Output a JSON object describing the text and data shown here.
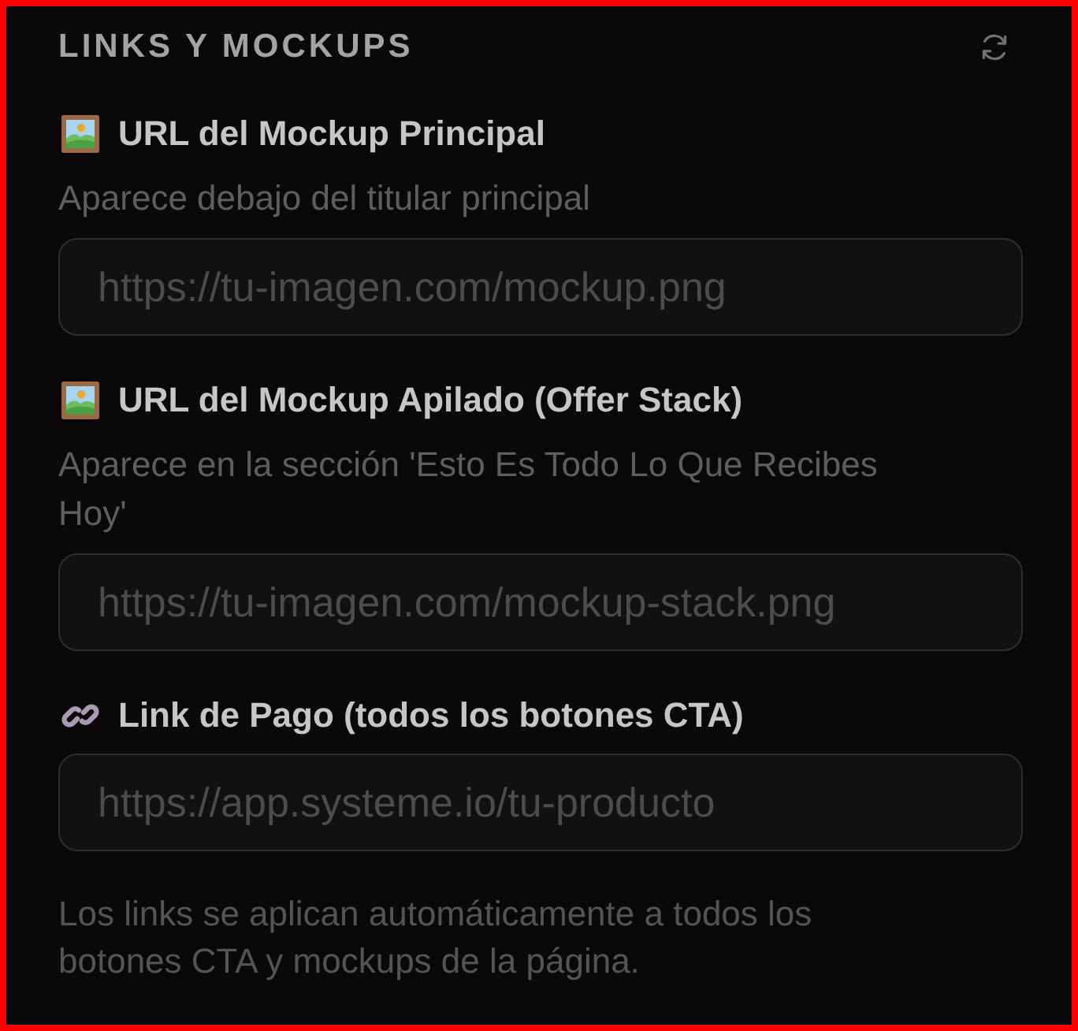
{
  "panel": {
    "title": "LINKS Y MOCKUPS"
  },
  "fields": [
    {
      "kind": "image",
      "label": "URL del Mockup Principal",
      "hint": "Aparece debajo del titular principal",
      "placeholder": "https://tu-imagen.com/mockup.png"
    },
    {
      "kind": "image",
      "label": "URL del Mockup Apilado (Offer Stack)",
      "hint": "Aparece en la sección 'Esto Es Todo Lo Que Recibes Hoy'",
      "placeholder": "https://tu-imagen.com/mockup-stack.png"
    },
    {
      "kind": "link",
      "label": "Link de Pago (todos los botones CTA)",
      "placeholder": "https://app.systeme.io/tu-producto"
    }
  ],
  "footer_note": "Los links se aplican automáticamente a todos los botones CTA y mockups de la página."
}
